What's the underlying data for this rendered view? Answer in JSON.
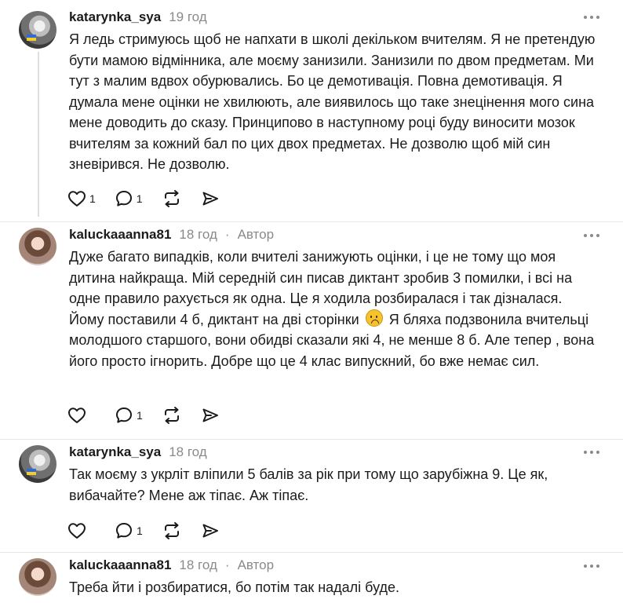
{
  "comments": [
    {
      "username": "katarynka_sya",
      "time": "19 год",
      "author": "",
      "avatar": "dark",
      "text": "Я ледь стримуюсь щоб не напхати в школі декільком вчителям. Я не претендую бути мамою відмінника, але моєму занизили. Занизили по двом предметам. Ми тут з малим вдвох обурювались. Бо це демотивація. Повна демотивація. Я думала мене оцінки не хвилюють, але виявилось що таке знецінення мого сина мене доводить до сказу. Принципово в наступному році буду виносити мозок вчителям за кожний бал по цих двох предметах. Не дозволю щоб мій син зневірився. Не дозволю.",
      "likes": "1",
      "replies": "1"
    },
    {
      "username": "kaluckaaanna81",
      "time": "18 год",
      "author": "Автор",
      "avatar": "light",
      "text_part1": "Дуже багато випадків, коли вчителі занижують оцінки, і це не тому що моя дитина найкраща. Мій середній син писав диктант зробив 3 помилки, і всі на одне правило рахується як одна. Це я ходила розбиралася і так дізналася. Йому поставили 4 б, диктант на дві сторінки",
      "text_part2": "Я бляха подзвонила вчительці молодшого старшого, вони обидві сказали які 4, не менше 8 б. Але тепер , вона його просто ігнорить. Добре що це 4 клас випускний, бо вже немає сил.",
      "emoji": "frowning-face-emoji",
      "likes": "",
      "replies": "1"
    },
    {
      "username": "katarynka_sya",
      "time": "18 год",
      "author": "",
      "avatar": "dark",
      "text": "Так моєму з укрліт вліпили 5 балів за рік при тому що зарубіжна 9. Це як, вибачайте? Мене аж тіпає. Аж тіпає.",
      "likes": "",
      "replies": "1"
    },
    {
      "username": "kaluckaaanna81",
      "time": "18 год",
      "author": "Автор",
      "avatar": "light",
      "text": "Треба йти і розбиратися, бо потім так надалі буде."
    }
  ],
  "separator_dot": "·",
  "icons": {
    "like": "heart-icon",
    "reply": "comment-bubble-icon",
    "repost": "repost-arrows-icon",
    "share": "send-arrow-icon",
    "more": "more-horizontal-icon"
  },
  "colors": {
    "text": "#1b1b1b",
    "muted": "#8a8a8a",
    "divider": "#e6e6e6",
    "thread_line": "#dedede"
  }
}
